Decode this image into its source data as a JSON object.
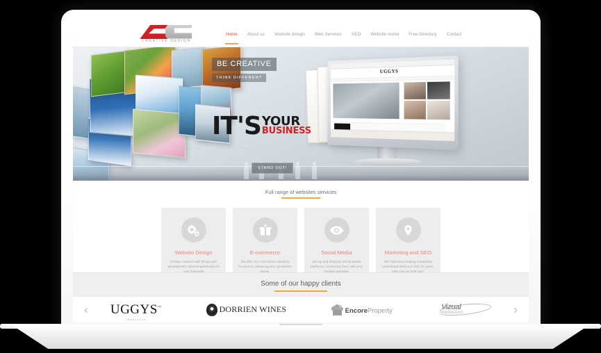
{
  "device": {
    "type": "laptop-mockup",
    "background_color": "#000000",
    "bezel_color": "#ffffff"
  },
  "site": {
    "logo": {
      "mark_letters": "DC",
      "tagline": "CREATIVE DESIGN",
      "red": "#cf2027",
      "grey": "#b5b5b5"
    },
    "nav": {
      "items": [
        {
          "label": "Home",
          "active": true
        },
        {
          "label": "About us",
          "active": false
        },
        {
          "label": "Website design",
          "active": false
        },
        {
          "label": "Web Services",
          "active": false
        },
        {
          "label": "SEO",
          "active": false
        },
        {
          "label": "Website rental",
          "active": false
        },
        {
          "label": "Free Directory",
          "active": false
        },
        {
          "label": "Contact",
          "active": false
        }
      ],
      "active_color": "#e8453c",
      "inactive_color": "#9d9d9d",
      "underline_color": "#f0a830"
    },
    "hero": {
      "tagline_primary": "BE CREATIVE",
      "tagline_secondary": "THINK DIFFERENT",
      "headline_part1": "IT'S",
      "headline_part2": "YOUR",
      "headline_part3": "BUSINESS",
      "headline_accent_color": "#d6201f",
      "cta_label": "STAND OUT!",
      "binary_overlay": "01 0101 001 0001 0101 01 001 0101 00101 01 0001 1001 0101 001 01101 0011 01 0101 001 0001 0101 01 001 0101 00101 01 0001"
    },
    "services": {
      "heading": "Full range of websites services",
      "accent_color": "#f0a830",
      "cards": [
        {
          "icon": "gears-icon",
          "title": "Website Design",
          "description": "Unique, creative web design and development, tailored specifically for your business!"
        },
        {
          "icon": "gift-icon",
          "title": "E-commerce",
          "description": "We offer an e-commerce solutions focused on delivering next generation stores."
        },
        {
          "icon": "eye-icon",
          "title": "Social Media",
          "description": "Set-up and integrate Social Media platforms, connecting them with your existing websites."
        },
        {
          "icon": "map-pin-icon",
          "title": "Marketing and SEO",
          "description": "We have been helping companies understand SEM and SEO for years. How can we help you?"
        }
      ],
      "card_title_color": "#ef7f7c",
      "card_background": "#ededed"
    },
    "clients": {
      "heading": "Some of our happy clients",
      "accent_color": "#f0a830",
      "prev_arrow": "‹",
      "next_arrow": "›",
      "logos": [
        {
          "name": "UGGYS",
          "trademark": "™",
          "subtext": "SHEEPSKIN"
        },
        {
          "name": "DORRIEN WINES",
          "emblem": "crest-icon"
        },
        {
          "name_bold": "Encore",
          "name_light": "Property",
          "emblem": "house-icon"
        },
        {
          "name_top": "Vizual",
          "name_bottom": "Impression",
          "emblem": "swoosh-icon"
        }
      ]
    }
  }
}
